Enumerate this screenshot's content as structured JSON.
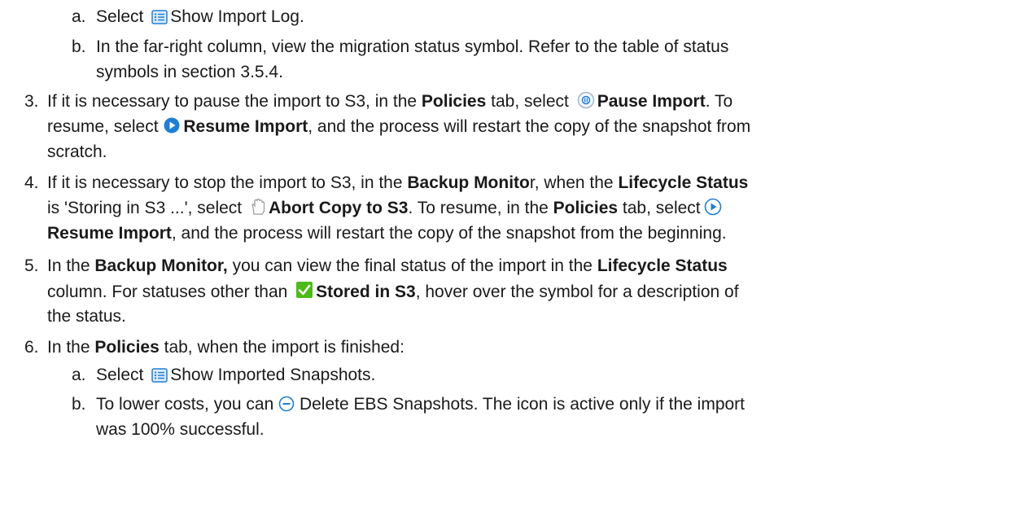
{
  "steps": {
    "s2a": {
      "marker": "a.",
      "pre": "Select ",
      "post": "Show Import Log."
    },
    "s2b": {
      "marker": "b.",
      "line1": "In the far-right column, view the migration status symbol. Refer to the table of status",
      "line2": "symbols in section 3.5.4."
    },
    "s3": {
      "marker": "3.",
      "t1": "If it is necessary to pause the import to S3, in the ",
      "b1": "Policies",
      "t2": " tab, select ",
      "b2": "Pause Import",
      "t3": ". To",
      "t4": "resume, select ",
      "b3": "Resume Import",
      "t5": ", and the process will restart the copy of the snapshot from",
      "t6": "scratch."
    },
    "s4": {
      "marker": "4.",
      "t1": "If it is necessary to stop the import to S3, in the ",
      "b1": "Backup Monito",
      "t2": "r, when the ",
      "b2": "Lifecycle Status",
      "t3": "is 'Storing in S3 ...', select ",
      "b3": "Abort Copy to S3",
      "t4": ". To resume, in the ",
      "b4": "Policies",
      "t5": " tab, select",
      "b5": "Resume Import",
      "t6": ", and the process will restart the copy of the snapshot from the beginning."
    },
    "s5": {
      "marker": "5.",
      "t1": "In the ",
      "b1": "Backup Monitor,",
      "t2": " you can view the final status of the import in the ",
      "b2": "Lifecycle Status",
      "t3": "column. For statuses other than ",
      "b3": "Stored in S3",
      "t4": ", hover over the symbol for a description of",
      "t5": "the status."
    },
    "s6": {
      "marker": "6.",
      "t1": "In the ",
      "b1": "Policies",
      "t2": " tab, when the import is finished:"
    },
    "s6a": {
      "marker": "a.",
      "pre": "Select ",
      "post": "Show Imported Snapshots."
    },
    "s6b": {
      "marker": "b.",
      "pre": "To lower costs, you can ",
      "post": " Delete EBS Snapshots. The icon is active only if the import",
      "line2": "was 100% successful."
    }
  },
  "icons": {
    "list": "list-icon",
    "pause": "pause-circle-icon",
    "resume": "play-circle-icon",
    "abort": "hand-icon",
    "stored": "green-check-icon",
    "delete": "minus-circle-icon"
  },
  "colors": {
    "text": "#1a1a1a",
    "icon_blue": "#1e7fd6",
    "check_green": "#4cbb17"
  }
}
